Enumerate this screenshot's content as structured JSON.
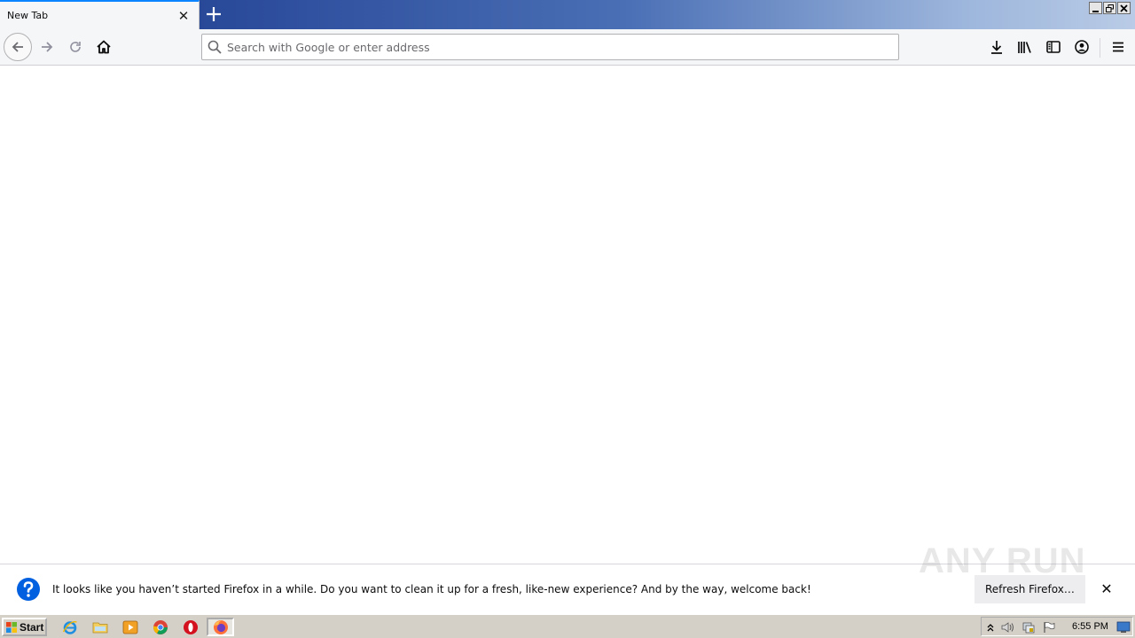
{
  "tab": {
    "title": "New Tab"
  },
  "urlbar": {
    "placeholder": "Search with Google or enter address",
    "value": ""
  },
  "notification": {
    "message": "It looks like you haven’t started Firefox in a while. Do you want to clean it up for a fresh, like-new experience? And by the way, welcome back!",
    "action_label": "Refresh Firefox…"
  },
  "watermark": {
    "text": "ANY RUN"
  },
  "taskbar": {
    "start_label": "Start",
    "clock": "6:55 PM",
    "apps": [
      "internet-explorer-icon",
      "file-explorer-icon",
      "media-player-icon",
      "chrome-icon",
      "opera-icon",
      "firefox-icon"
    ]
  },
  "colors": {
    "accent": "#0a84ff",
    "notif_icon": "#0060df",
    "taskbar": "#d4d0c8"
  }
}
